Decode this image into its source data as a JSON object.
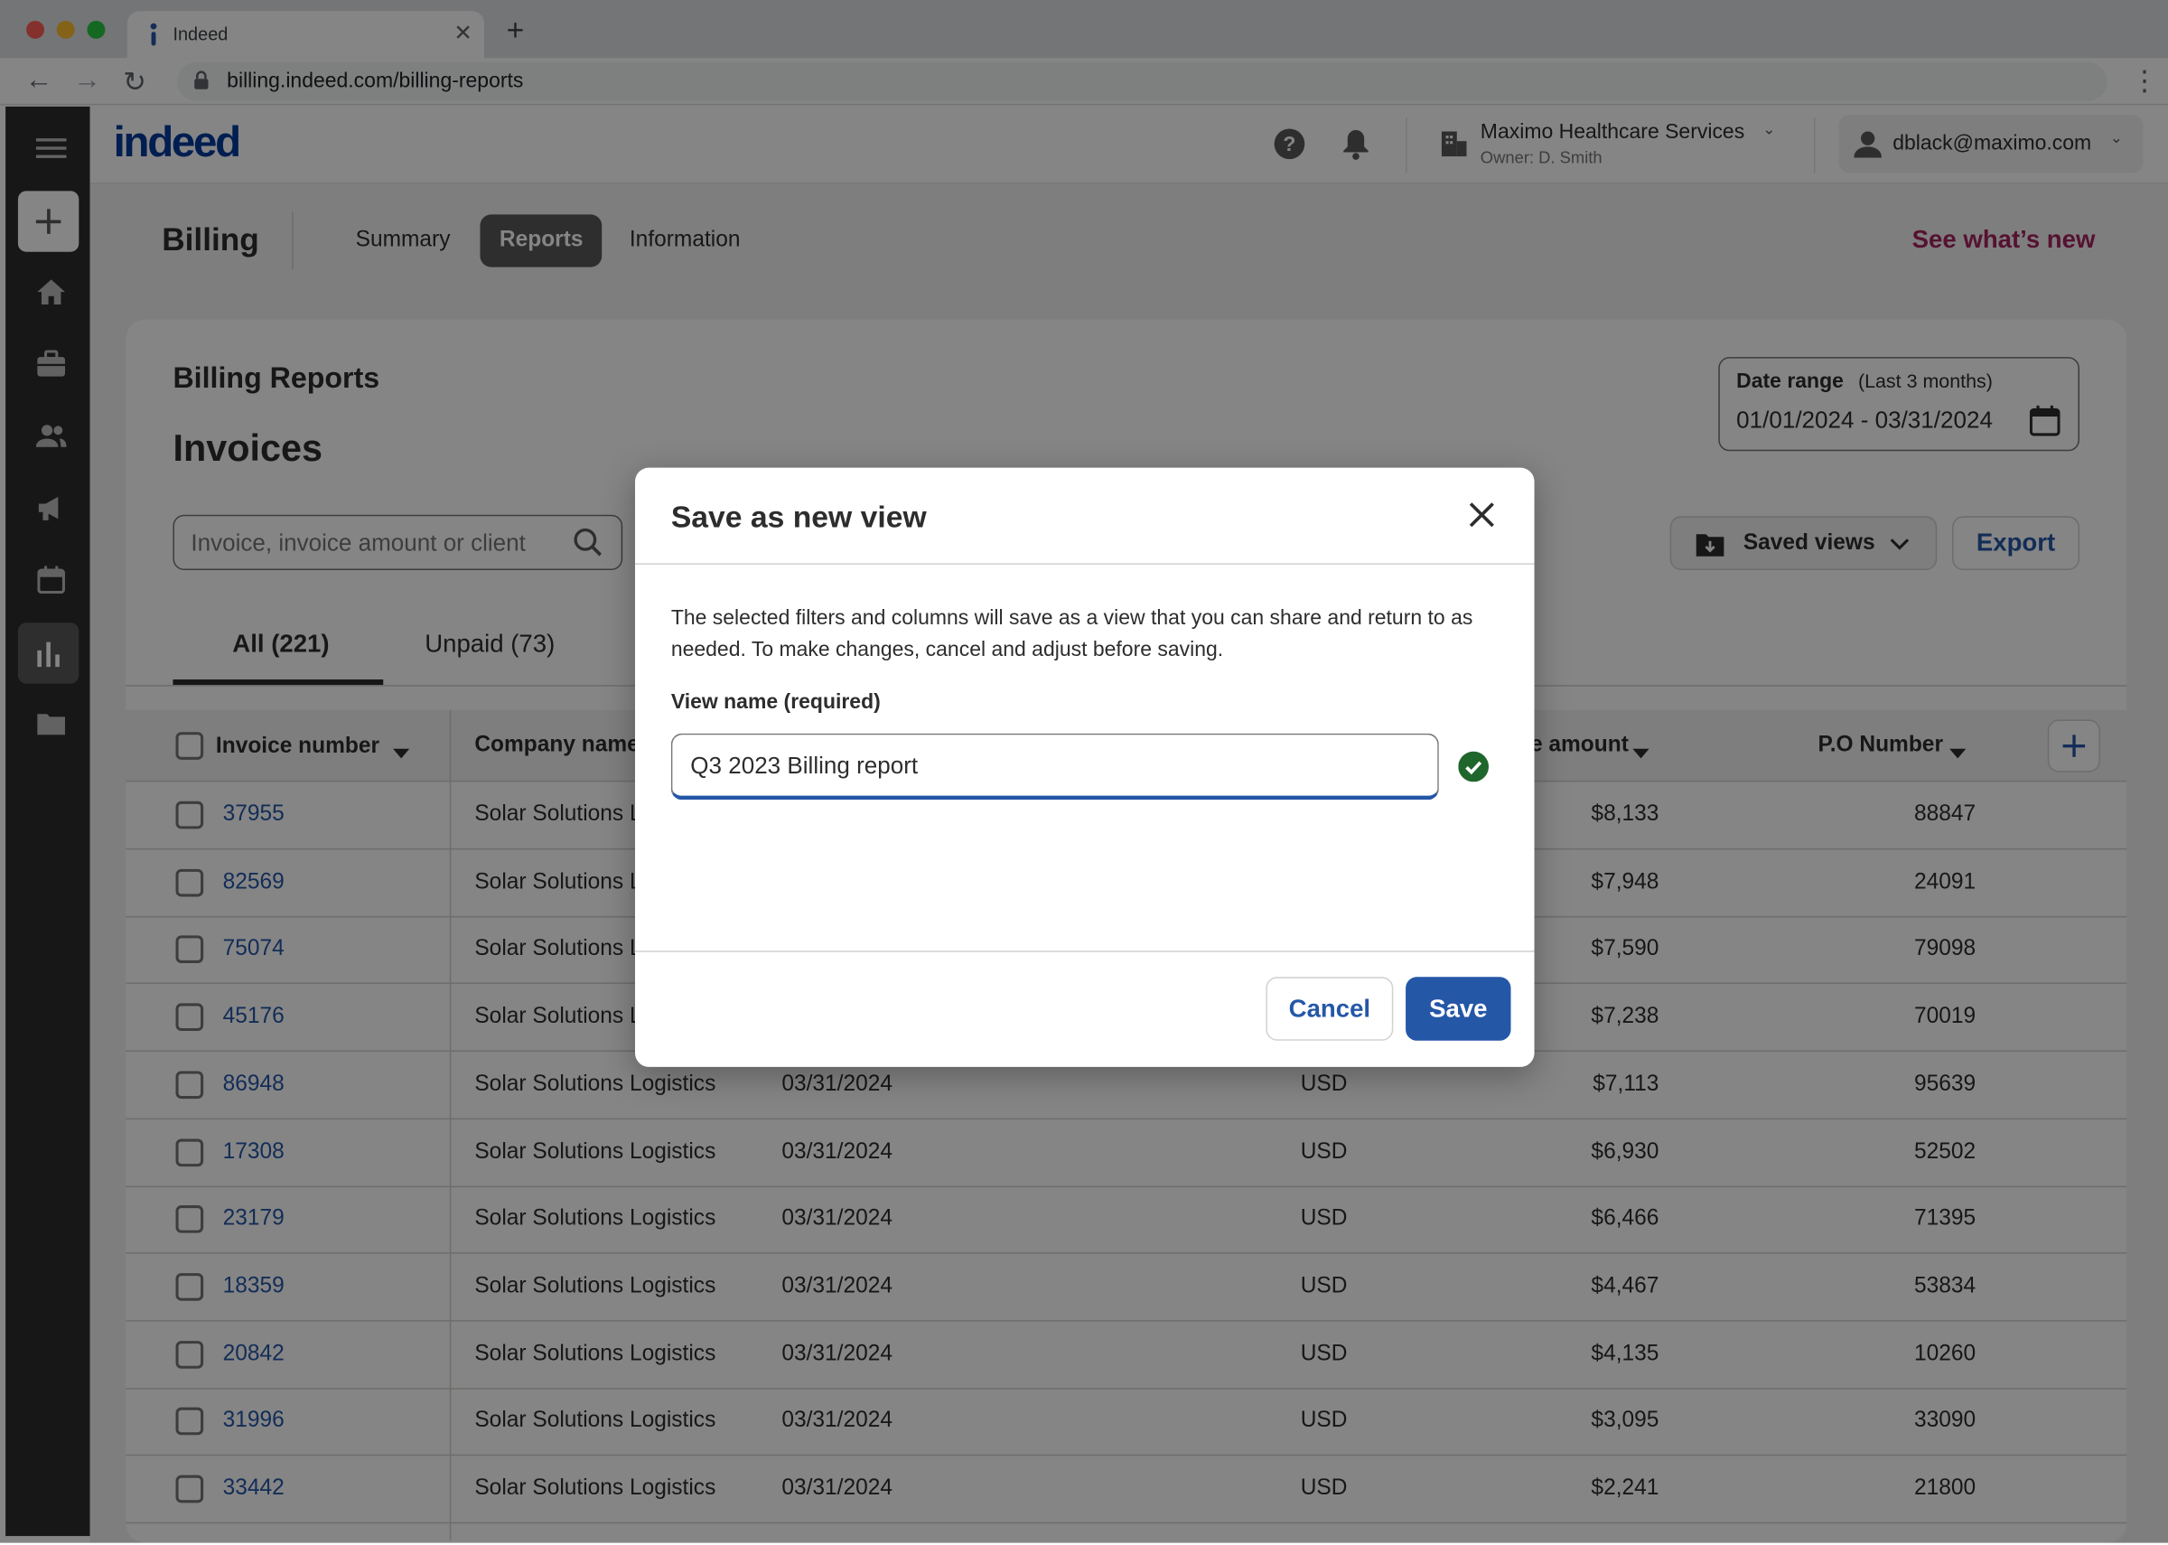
{
  "browser": {
    "tab_title": "Indeed",
    "url": "billing.indeed.com/billing-reports"
  },
  "header": {
    "logo": "indeed",
    "company_name": "Maximo Healthcare Services",
    "company_owner": "Owner: D. Smith",
    "user_email": "dblack@maximo.com"
  },
  "billing_nav": {
    "title": "Billing",
    "tabs": [
      "Summary",
      "Reports",
      "Information"
    ],
    "active_tab": "Reports",
    "whats_new": "See what’s new"
  },
  "reports": {
    "section_title": "Billing Reports",
    "heading": "Invoices",
    "search_placeholder": "Invoice, invoice amount or client",
    "date_range_label": "Date range",
    "date_range_hint": "(Last 3 months)",
    "date_range_value": "01/01/2024 - 03/31/2024",
    "saved_views_label": "Saved views",
    "export_label": "Export",
    "filter_tabs": [
      "All (221)",
      "Unpaid (73)"
    ]
  },
  "table": {
    "columns": [
      "Invoice number",
      "Company name",
      "e amount",
      "P.O Number"
    ],
    "rows": [
      {
        "invoice": "37955",
        "company": "Solar Solutions L",
        "date": "",
        "currency": "",
        "amount": "$8,133",
        "po": "88847"
      },
      {
        "invoice": "82569",
        "company": "Solar Solutions L",
        "date": "",
        "currency": "",
        "amount": "$7,948",
        "po": "24091"
      },
      {
        "invoice": "75074",
        "company": "Solar Solutions L",
        "date": "",
        "currency": "",
        "amount": "$7,590",
        "po": "79098"
      },
      {
        "invoice": "45176",
        "company": "Solar Solutions L",
        "date": "",
        "currency": "",
        "amount": "$7,238",
        "po": "70019"
      },
      {
        "invoice": "86948",
        "company": "Solar Solutions Logistics",
        "date": "03/31/2024",
        "currency": "USD",
        "amount": "$7,113",
        "po": "95639"
      },
      {
        "invoice": "17308",
        "company": "Solar Solutions Logistics",
        "date": "03/31/2024",
        "currency": "USD",
        "amount": "$6,930",
        "po": "52502"
      },
      {
        "invoice": "23179",
        "company": "Solar Solutions Logistics",
        "date": "03/31/2024",
        "currency": "USD",
        "amount": "$6,466",
        "po": "71395"
      },
      {
        "invoice": "18359",
        "company": "Solar Solutions Logistics",
        "date": "03/31/2024",
        "currency": "USD",
        "amount": "$4,467",
        "po": "53834"
      },
      {
        "invoice": "20842",
        "company": "Solar Solutions Logistics",
        "date": "03/31/2024",
        "currency": "USD",
        "amount": "$4,135",
        "po": "10260"
      },
      {
        "invoice": "31996",
        "company": "Solar Solutions Logistics",
        "date": "03/31/2024",
        "currency": "USD",
        "amount": "$3,095",
        "po": "33090"
      },
      {
        "invoice": "33442",
        "company": "Solar Solutions Logistics",
        "date": "03/31/2024",
        "currency": "USD",
        "amount": "$2,241",
        "po": "21800"
      }
    ]
  },
  "modal": {
    "title": "Save as new view",
    "description": "The selected filters and columns will save as a view that you can share and return to as needed. To make changes, cancel and adjust before saving.",
    "field_label": "View name (required)",
    "field_value": "Q3 2023 Billing report",
    "cancel_label": "Cancel",
    "save_label": "Save"
  },
  "colors": {
    "brand_blue": "#2557a7",
    "link_blue": "#2557a7",
    "whats_new_magenta": "#a3235f",
    "success_green": "#1f662c",
    "rail_dark": "#2d2d2d"
  }
}
